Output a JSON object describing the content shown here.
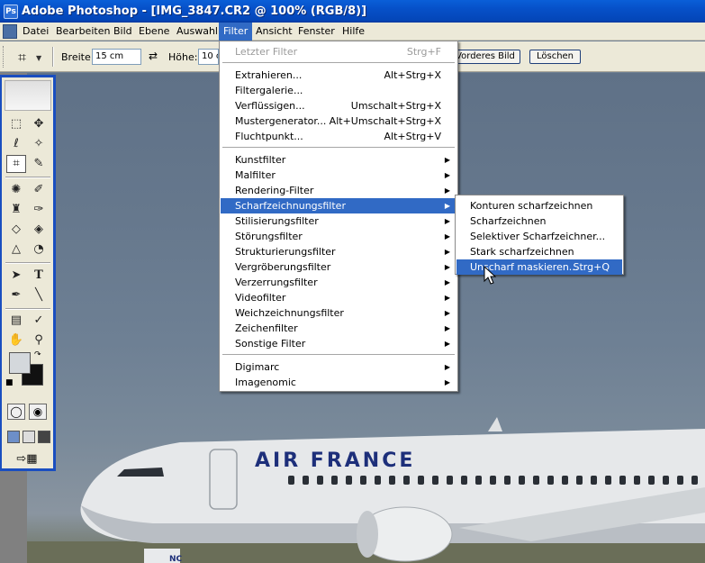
{
  "window": {
    "title": "Adobe Photoshop - [IMG_3847.CR2 @ 100% (RGB/8)]"
  },
  "menubar": [
    {
      "label": "Datei"
    },
    {
      "label": "Bearbeiten"
    },
    {
      "label": "Bild"
    },
    {
      "label": "Ebene"
    },
    {
      "label": "Auswahl"
    },
    {
      "label": "Filter"
    },
    {
      "label": "Ansicht"
    },
    {
      "label": "Fenster"
    },
    {
      "label": "Hilfe"
    }
  ],
  "options": {
    "width_label": "Breite:",
    "width_value": "15 cm",
    "height_label": "Höhe:",
    "height_value": "10 c",
    "front_image_button": "Vorderes Bild",
    "clear_button": "Löschen"
  },
  "filter_menu": {
    "items": [
      {
        "label": "Letzter Filter",
        "shortcut": "Strg+F",
        "disabled": true
      },
      {
        "label": "Extrahieren...",
        "shortcut": "Alt+Strg+X"
      },
      {
        "label": "Filtergalerie..."
      },
      {
        "label": "Verflüssigen...",
        "shortcut": "Umschalt+Strg+X"
      },
      {
        "label": "Mustergenerator...",
        "shortcut": "Alt+Umschalt+Strg+X"
      },
      {
        "label": "Fluchtpunkt...",
        "shortcut": "Alt+Strg+V"
      },
      {
        "label": "Kunstfilter",
        "submenu": true
      },
      {
        "label": "Malfilter",
        "submenu": true
      },
      {
        "label": "Rendering-Filter",
        "submenu": true
      },
      {
        "label": "Scharfzeichnungsfilter",
        "submenu": true,
        "highlighted": true
      },
      {
        "label": "Stilisierungsfilter",
        "submenu": true
      },
      {
        "label": "Störungsfilter",
        "submenu": true
      },
      {
        "label": "Strukturierungsfilter",
        "submenu": true
      },
      {
        "label": "Vergröberungsfilter",
        "submenu": true
      },
      {
        "label": "Verzerrungsfilter",
        "submenu": true
      },
      {
        "label": "Videofilter",
        "submenu": true
      },
      {
        "label": "Weichzeichnungsfilter",
        "submenu": true
      },
      {
        "label": "Zeichenfilter",
        "submenu": true
      },
      {
        "label": "Sonstige Filter",
        "submenu": true
      },
      {
        "label": "Digimarc",
        "submenu": true
      },
      {
        "label": "Imagenomic",
        "submenu": true
      }
    ]
  },
  "sharpen_submenu": {
    "items": [
      {
        "label": "Konturen scharfzeichnen"
      },
      {
        "label": "Scharfzeichnen"
      },
      {
        "label": "Selektiver Scharfzeichner..."
      },
      {
        "label": "Stark scharfzeichnen"
      },
      {
        "label": "Unscharf maskieren...",
        "shortcut": "Strg+Q",
        "highlighted": true
      }
    ]
  },
  "image": {
    "airline_text": "AIR FRANCE",
    "nose_text": "NC",
    "sky_color": "#66788d"
  },
  "colors": {
    "accent": "#316ac5",
    "titlebar": "#0650c8",
    "toolbox_border": "#1a4ec0",
    "foreground_swatch": "#d4d8dc",
    "background_swatch": "#111111"
  }
}
